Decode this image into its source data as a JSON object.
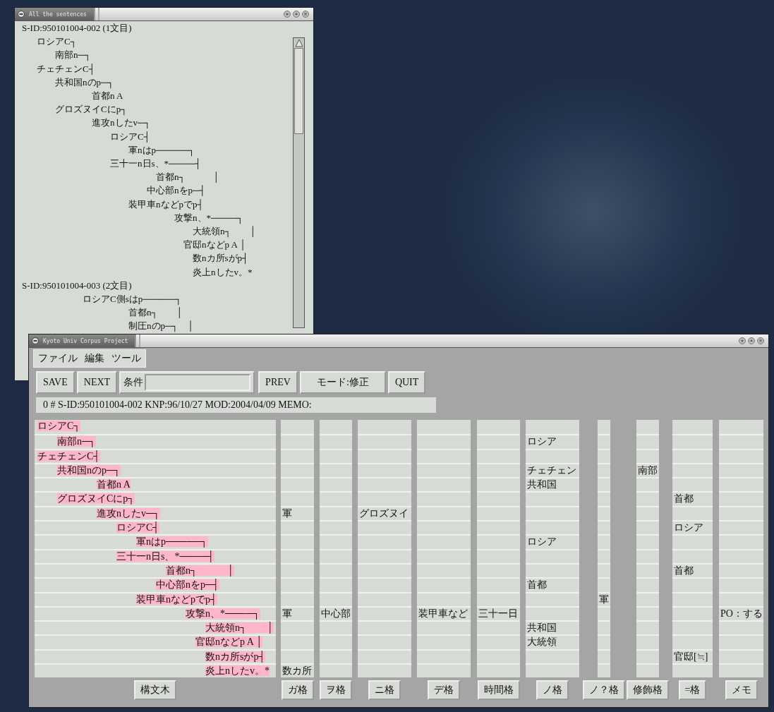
{
  "sentences_window": {
    "title": "All the sentences",
    "sentences": [
      {
        "header": "S-ID:950101004-002 (1文目)",
        "lines": [
          "ロシアC┐",
          "　　南部n─┐",
          "チェチェンC┤",
          "　　共和国nのp─┐",
          "　　　　　　首都n A",
          "　　グロズヌイCにp┐",
          "　　　　　　進攻nしたv─┐",
          "　　　　　　　　ロシアC┤",
          "　　　　　　　　　　軍nはp─────┐",
          "　　　　　　　　三十一n日s、*────┤",
          "　　　　　　　　　　　　　首都n┐　　　│",
          "　　　　　　　　　　　　中心部nをp─┤",
          "　　　　　　　　　　装甲車nなどpでp┤",
          "　　　　　　　　　　　　　　　攻撃n、*────┐",
          "　　　　　　　　　　　　　　　　　大統領n┐　　│",
          "　　　　　　　　　　　　　　　　官邸nなどp A │",
          "　　　　　　　　　　　　　　　　　数nカ所sがp┤",
          "　　　　　　　　　　　　　　　　　炎上nしたv。*"
        ]
      },
      {
        "header": "S-ID:950101004-003 (2文目)",
        "lines": [
          "　　　　　ロシアC側sはp─────┐",
          "　　　　　　　　　　首都n┐　　│",
          "　　　　　　　　　　制圧nのp─┐　│"
        ]
      }
    ]
  },
  "main_window": {
    "title": "Kyoto Univ Corpus Project",
    "menu": [
      "ファイル",
      "編集",
      "ツール"
    ],
    "toolbar": [
      {
        "kind": "button",
        "label": "SAVE"
      },
      {
        "kind": "button",
        "label": "NEXT"
      },
      {
        "kind": "field",
        "label": "条件"
      },
      {
        "kind": "button",
        "label": "PREV"
      },
      {
        "kind": "button",
        "label": "モード:修正"
      },
      {
        "kind": "button",
        "label": "QUIT"
      }
    ],
    "info": "0 # S-ID:950101004-002 KNP:96/10/27 MOD:2004/04/09 MEMO:",
    "tree_rows": [
      "ロシアC┐",
      "　　南部n─┐",
      "チェチェンC┤",
      "　　共和国nのp─┐",
      "　　　　　　首都n A",
      "　　グロズヌイCにp┐",
      "　　　　　　進攻nしたv─┐",
      "　　　　　　　　ロシアC┤",
      "　　　　　　　　　　軍nはp─────┐",
      "　　　　　　　　三十一n日s、*────┤",
      "　　　　　　　　　　　　　首都n┐　　　│",
      "　　　　　　　　　　　　中心部nをp─┤",
      "　　　　　　　　　　装甲車nなどpでp┤",
      "　　　　　　　　　　　　　　　攻撃n、*────┐",
      "　　　　　　　　　　　　　　　　　大統領n┐　　│",
      "　　　　　　　　　　　　　　　　官邸nなどp A │",
      "　　　　　　　　　　　　　　　　　数nカ所sがp┤",
      "　　　　　　　　　　　　　　　　　炎上nしたv。*"
    ],
    "tree_button": "構文木",
    "case_columns": [
      {
        "button": "ガ格",
        "cells": [
          null,
          null,
          null,
          null,
          null,
          null,
          "軍",
          null,
          null,
          null,
          null,
          null,
          null,
          "軍",
          null,
          null,
          null,
          "数カ所"
        ]
      },
      {
        "button": "ヲ格",
        "cells": [
          null,
          null,
          null,
          null,
          null,
          null,
          null,
          null,
          null,
          null,
          null,
          null,
          null,
          "中心部",
          null,
          null,
          null,
          null
        ]
      },
      {
        "button": "ニ格",
        "cells": [
          null,
          null,
          null,
          null,
          null,
          null,
          "グロズヌイ",
          null,
          null,
          null,
          null,
          null,
          null,
          null,
          null,
          null,
          null,
          null
        ]
      },
      {
        "button": "デ格",
        "cells": [
          null,
          null,
          null,
          null,
          null,
          null,
          null,
          null,
          null,
          null,
          null,
          null,
          null,
          "装甲車など",
          null,
          null,
          null,
          null
        ]
      },
      {
        "button": "時間格",
        "cells": [
          null,
          null,
          null,
          null,
          null,
          null,
          null,
          null,
          null,
          null,
          null,
          null,
          null,
          "三十一日",
          null,
          null,
          null,
          null
        ]
      },
      {
        "button": "ノ格",
        "cells": [
          null,
          "ロシア",
          null,
          "チェチェン",
          "共和国",
          null,
          null,
          null,
          "ロシア",
          null,
          null,
          "首都",
          null,
          null,
          "共和国",
          "大統領",
          null,
          null
        ]
      },
      {
        "button": "ノ？格",
        "cells": [
          null,
          null,
          null,
          null,
          null,
          null,
          null,
          null,
          null,
          null,
          null,
          null,
          "軍",
          null,
          null,
          null,
          null,
          null
        ]
      },
      {
        "button": "修飾格",
        "cells": [
          null,
          null,
          null,
          "南部",
          null,
          null,
          null,
          null,
          null,
          null,
          null,
          null,
          null,
          null,
          null,
          null,
          null,
          null
        ]
      },
      {
        "button": "=格",
        "cells": [
          null,
          null,
          null,
          null,
          null,
          "首都",
          null,
          "ロシア",
          null,
          null,
          "首都",
          null,
          null,
          null,
          null,
          null,
          "官邸[≒]",
          null
        ]
      },
      {
        "button": "メモ",
        "cells": [
          null,
          null,
          null,
          null,
          null,
          null,
          null,
          null,
          null,
          null,
          null,
          null,
          null,
          "PO：する",
          null,
          null,
          null,
          null
        ]
      }
    ]
  }
}
